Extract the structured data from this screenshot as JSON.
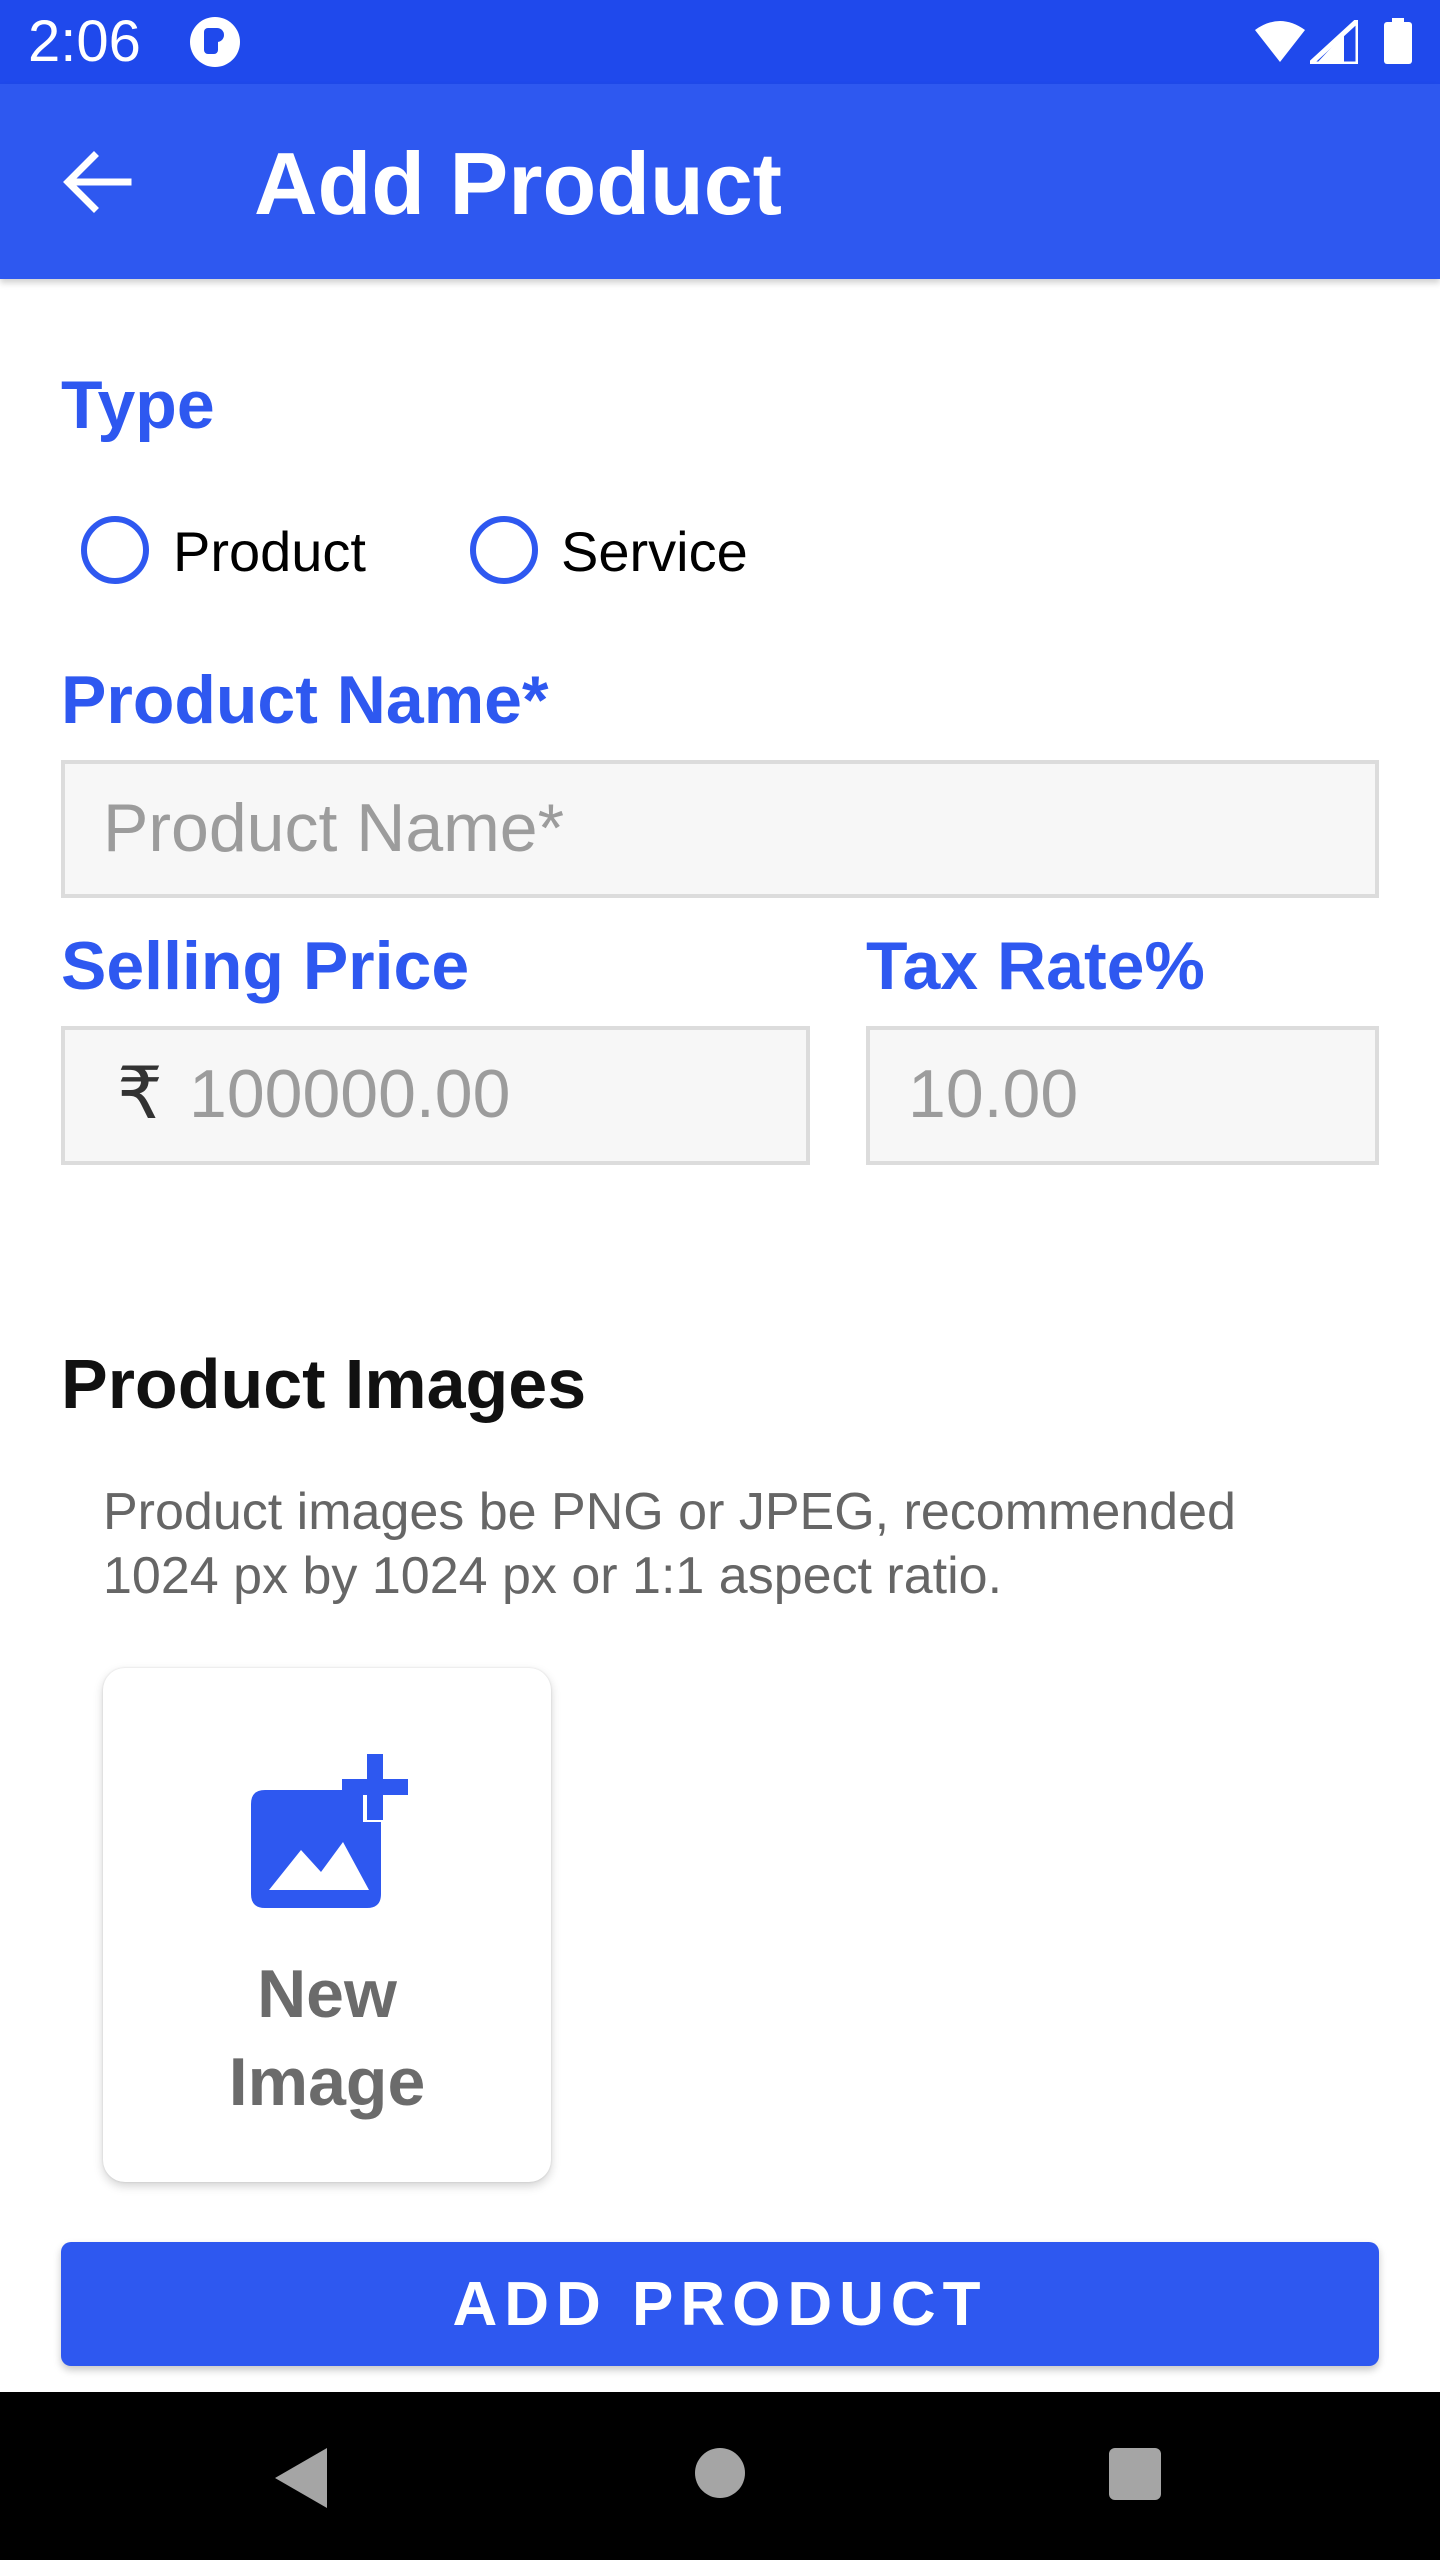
{
  "status_bar": {
    "time": "2:06"
  },
  "app_bar": {
    "title": "Add Product"
  },
  "type_section": {
    "label": "Type",
    "options": [
      {
        "label": "Product",
        "selected": false
      },
      {
        "label": "Service",
        "selected": false
      }
    ]
  },
  "product_name": {
    "label": "Product Name*",
    "placeholder": "Product Name*",
    "value": ""
  },
  "selling_price": {
    "label": "Selling Price",
    "currency_symbol": "₹",
    "placeholder": "100000.00",
    "value": ""
  },
  "tax_rate": {
    "label": "Tax Rate%",
    "placeholder": "10.00",
    "value": ""
  },
  "product_images": {
    "heading": "Product Images",
    "helper_text": "Product images be PNG or JPEG, recommended 1024 px by 1024 px or 1:1 aspect ratio.",
    "new_image_label": "New Image"
  },
  "submit": {
    "label": "ADD PRODUCT"
  },
  "colors": {
    "status_bar": "#1f49ec",
    "primary": "#2e58f0",
    "field_bg": "#f7f7f7",
    "field_border": "#dcdcdc"
  }
}
